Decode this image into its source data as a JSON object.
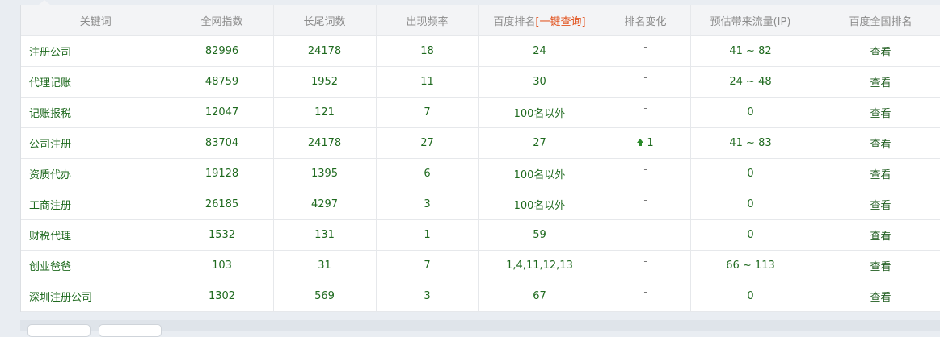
{
  "table": {
    "headers": {
      "keyword": "关键词",
      "index": "全网指数",
      "longtail": "长尾词数",
      "frequency": "出现频率",
      "baidu_rank": "百度排名",
      "baidu_rank_lookup": "[一键查询]",
      "rank_change": "排名变化",
      "traffic": "预估带来流量(IP)",
      "national_rank": "百度全国排名"
    },
    "rows": [
      {
        "keyword": "注册公司",
        "index": "82996",
        "longtail": "24178",
        "frequency": "18",
        "rank": "24",
        "change": "-",
        "traffic": "41 ~ 82",
        "view": "查看"
      },
      {
        "keyword": "代理记账",
        "index": "48759",
        "longtail": "1952",
        "frequency": "11",
        "rank": "30",
        "change": "-",
        "traffic": "24 ~ 48",
        "view": "查看"
      },
      {
        "keyword": "记账报税",
        "index": "12047",
        "longtail": "121",
        "frequency": "7",
        "rank": "100名以外",
        "change": "-",
        "traffic": "0",
        "view": "查看"
      },
      {
        "keyword": "公司注册",
        "index": "83704",
        "longtail": "24178",
        "frequency": "27",
        "rank": "27",
        "change": "1",
        "traffic": "41 ~ 83",
        "view": "查看"
      },
      {
        "keyword": "资质代办",
        "index": "19128",
        "longtail": "1395",
        "frequency": "6",
        "rank": "100名以外",
        "change": "-",
        "traffic": "0",
        "view": "查看"
      },
      {
        "keyword": "工商注册",
        "index": "26185",
        "longtail": "4297",
        "frequency": "3",
        "rank": "100名以外",
        "change": "-",
        "traffic": "0",
        "view": "查看"
      },
      {
        "keyword": "财税代理",
        "index": "1532",
        "longtail": "131",
        "frequency": "1",
        "rank": "59",
        "change": "-",
        "traffic": "0",
        "view": "查看"
      },
      {
        "keyword": "创业爸爸",
        "index": "103",
        "longtail": "31",
        "frequency": "7",
        "rank": "1,4,11,12,13",
        "change": "-",
        "traffic": "66 ~ 113",
        "view": "查看"
      },
      {
        "keyword": "深圳注册公司",
        "index": "1302",
        "longtail": "569",
        "frequency": "3",
        "rank": "67",
        "change": "-",
        "traffic": "0",
        "view": "查看"
      }
    ]
  },
  "icons": {
    "rank_up": "up-arrow-icon",
    "no_change": "dash"
  },
  "colors": {
    "text_green": "#1f6a1f",
    "header_gray": "#8c8c8c",
    "lookup_orange": "#e2531f",
    "header_bg": "#f3f4f6"
  }
}
